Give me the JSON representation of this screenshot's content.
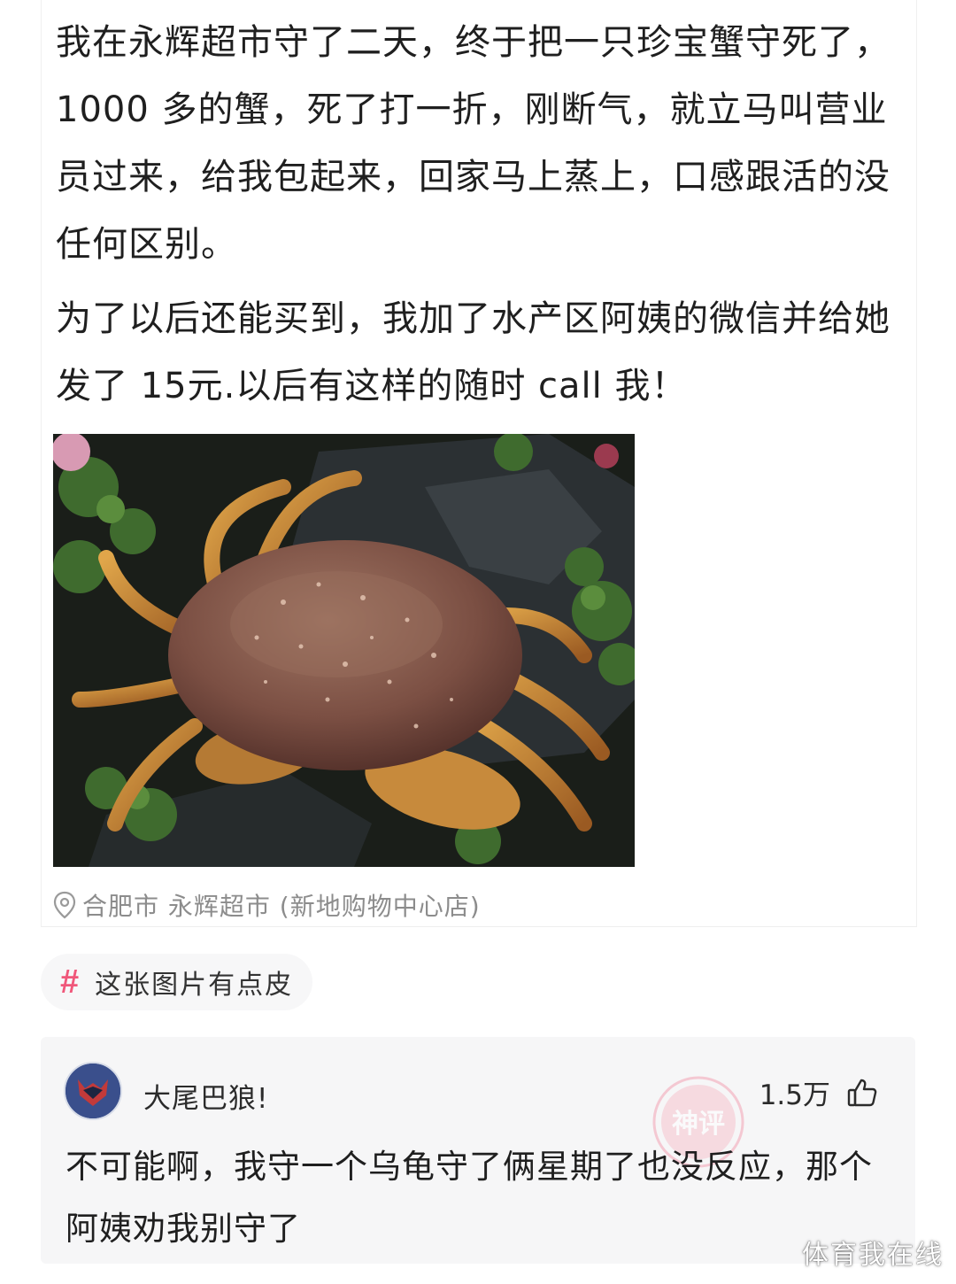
{
  "post": {
    "paragraph_1": "我在永辉超市守了二天，终于把一只珍宝蟹守死了，1000 多的蟹，死了打一折，刚断气，就立马叫营业员过来，给我包起来，回家马上蒸上，口感跟活的没任何区别。",
    "paragraph_2": "为了以后还能买到，我加了水产区阿姨的微信并给她发了 15元.以后有这样的随时 call 我！",
    "location": "合肥市 永辉超市 (新地购物中心店)",
    "location_icon": "location-pin-icon"
  },
  "topic": {
    "hash": "#",
    "label": "这张图片有点皮"
  },
  "comment": {
    "username": "大尾巴狼!",
    "likes": "1.5万",
    "like_icon": "thumbs-up-icon",
    "stamp_label": "神评",
    "text": "不可能啊，我守一个乌龟守了俩星期了也没反应，那个阿姨劝我别守了"
  },
  "watermark": "体育我在线",
  "colors": {
    "accent": "#f0577a",
    "muted_text": "#8c8c8c",
    "comment_bg": "#f6f6f7",
    "chip_bg": "#f7f7f8"
  }
}
